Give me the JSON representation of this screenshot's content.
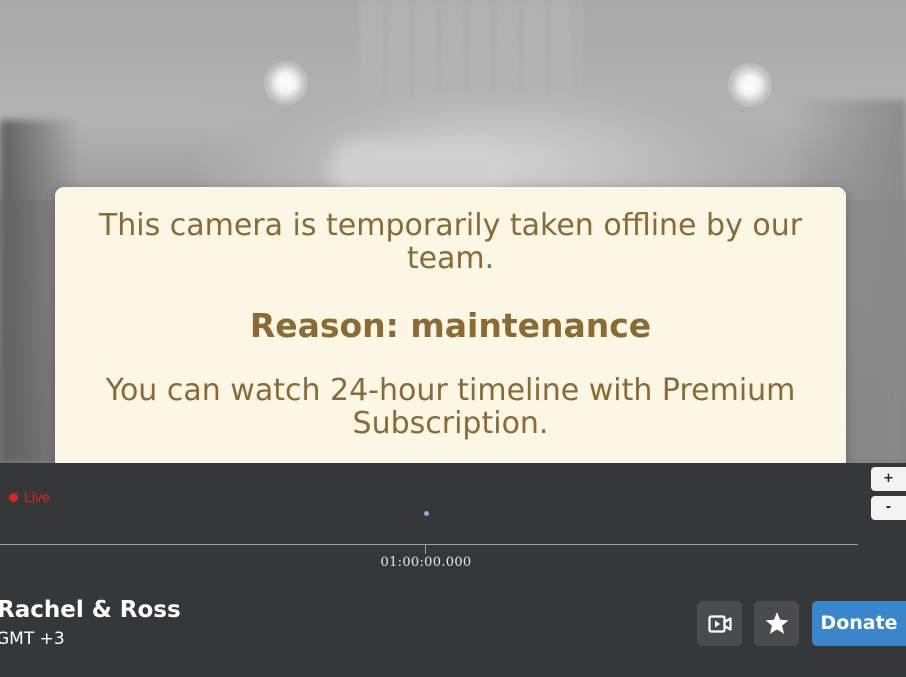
{
  "notice": {
    "message": "This camera is temporarily taken offline by our team.",
    "reason": "Reason: maintenance",
    "premium": "You can watch 24-hour timeline with Premium Subscription."
  },
  "timeline": {
    "live_label": "Live",
    "zoom_in_label": "+",
    "zoom_out_label": "-",
    "tick_label": "01:00:00.000"
  },
  "camera": {
    "name": "Rachel & Ross",
    "timezone": "GMT +3"
  },
  "actions": {
    "clip_icon": "video-clip-icon",
    "favorite_icon": "star-icon",
    "donate_label": "Donate"
  },
  "colors": {
    "notice_bg": "#fcf6e4",
    "notice_text": "#8a6a35",
    "live": "#e0231d",
    "donate": "#3a86cc",
    "panel": "#363739"
  }
}
